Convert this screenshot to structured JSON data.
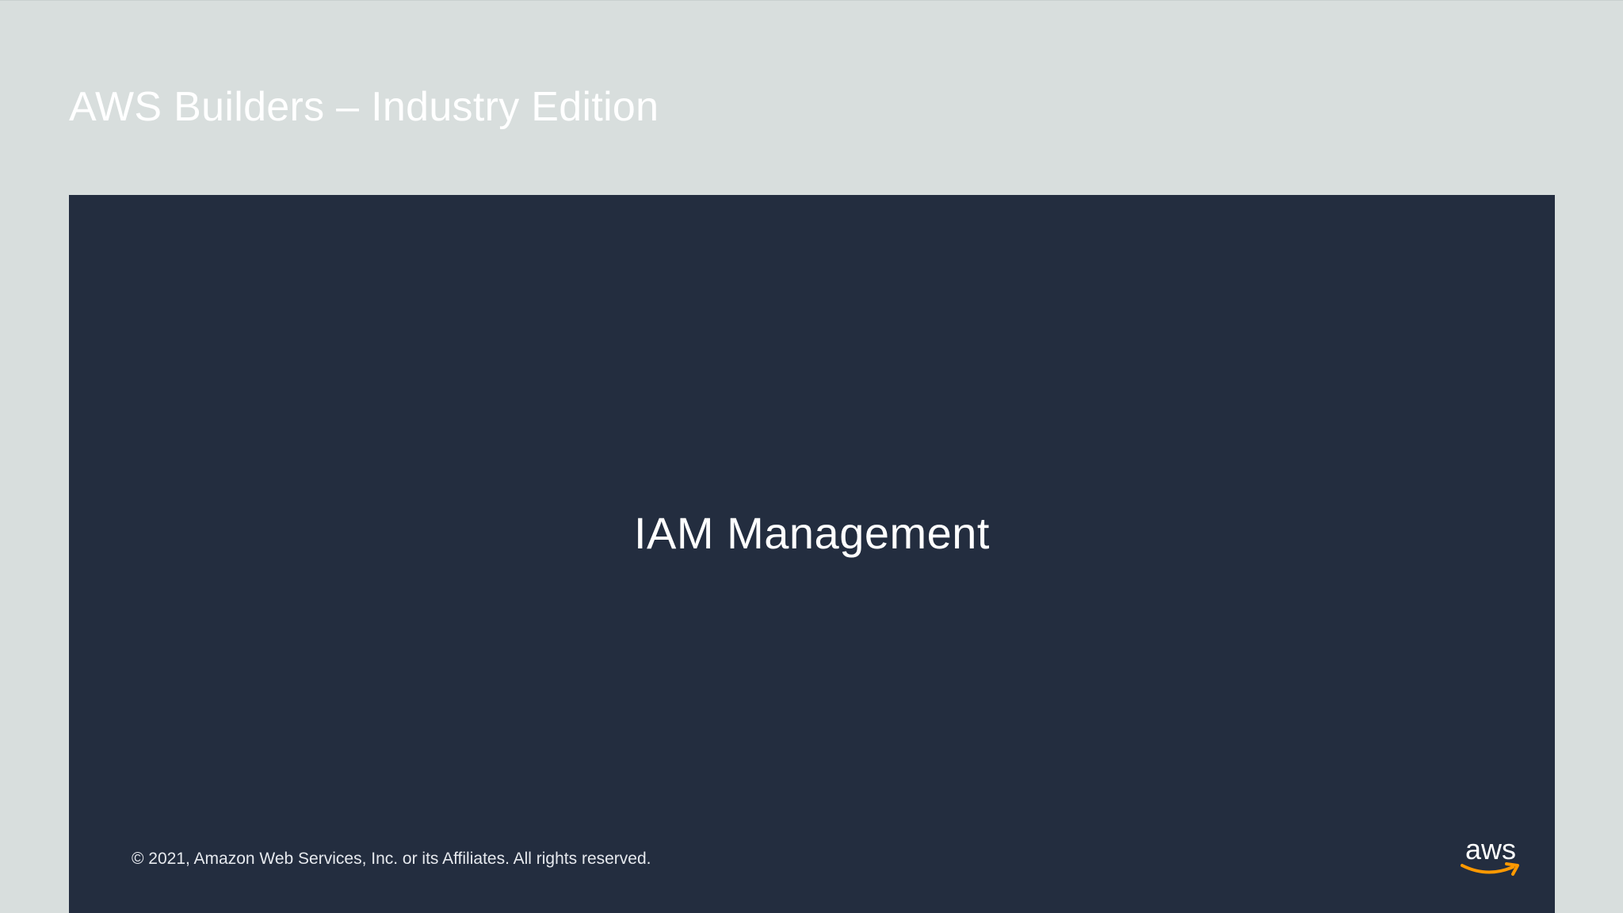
{
  "header": {
    "title": "AWS Builders – Industry Edition"
  },
  "slide": {
    "heading": "IAM Management",
    "footer": {
      "copyright": "© 2021, Amazon Web Services, Inc. or its Affiliates. All rights reserved.",
      "logo_text": "aws",
      "logo_icon": "aws-smile-icon"
    }
  },
  "colors": {
    "page_background": "#d8dedd",
    "slide_background": "#232d3f",
    "text": "#ffffff",
    "brand_accent": "#ff9900"
  }
}
